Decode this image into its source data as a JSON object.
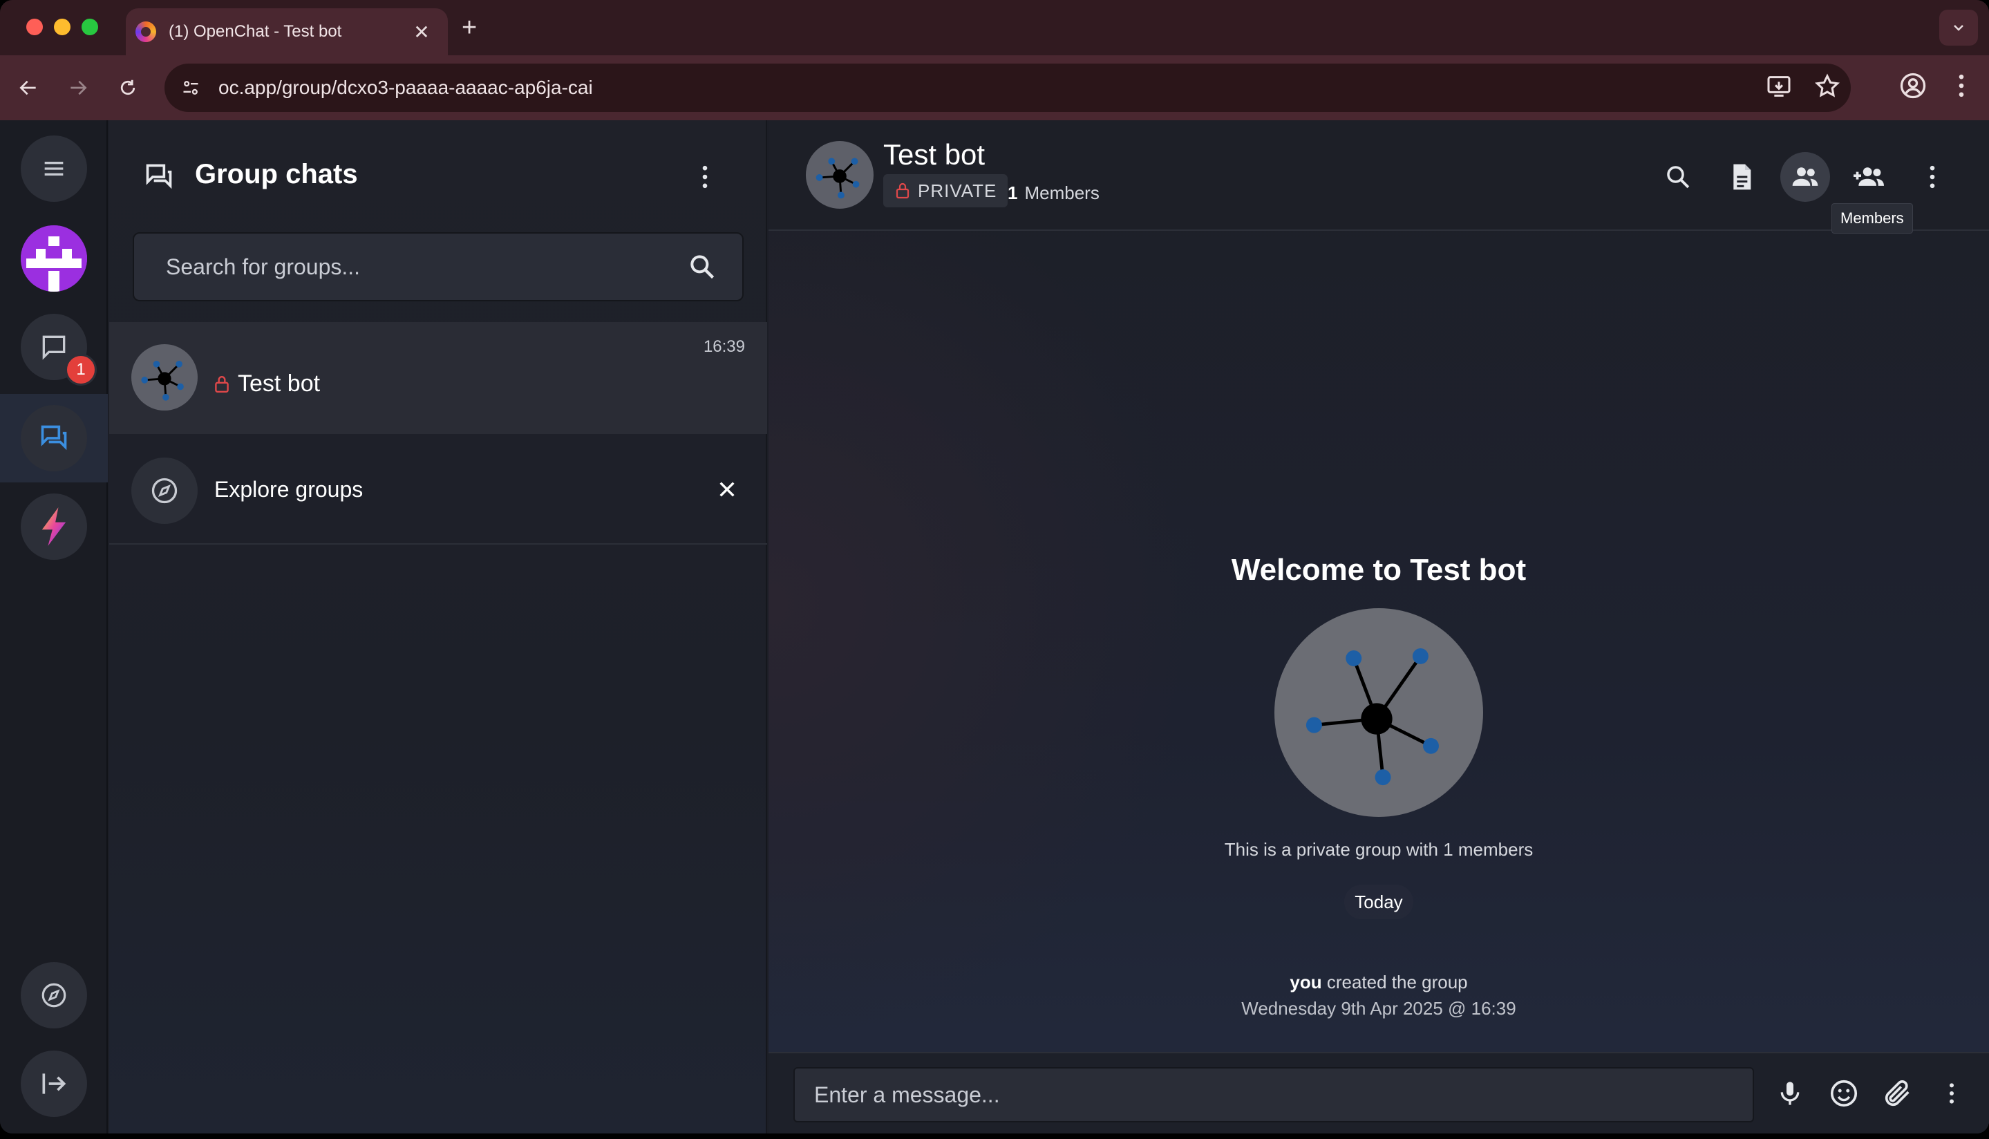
{
  "browser": {
    "tab_title": "(1) OpenChat - Test bot",
    "url": "oc.app/group/dcxo3-paaaa-aaaac-ap6ja-cai",
    "colors": {
      "frame": "#311a20",
      "toolbar": "#4a2730",
      "omnibox": "#2b1519"
    }
  },
  "rail": {
    "chats_badge": "1",
    "items": [
      "menu-icon",
      "user-avatar",
      "direct-chats-icon",
      "group-chats-icon",
      "lightning-icon",
      "explore-icon",
      "logout-icon"
    ]
  },
  "panel": {
    "title": "Group chats",
    "search_placeholder": "Search for groups...",
    "chats": [
      {
        "name": "Test bot",
        "time": "16:39",
        "private": true
      }
    ],
    "explore_label": "Explore groups"
  },
  "chat": {
    "title": "Test bot",
    "privacy_label": "PRIVATE",
    "members_count": "1",
    "members_label": "Members",
    "tooltip": "Members",
    "welcome_title": "Welcome to Test bot",
    "welcome_sub": "This is a private group with 1 members",
    "date_divider": "Today",
    "event_actor": "you",
    "event_text": "created the group",
    "event_date": "Wednesday 9th Apr 2025 @ 16:39",
    "composer_placeholder": "Enter a message..."
  },
  "colors": {
    "accent_blue": "#3b8fe0",
    "badge_red": "#e33f3b",
    "lock_red": "#e0484a"
  }
}
